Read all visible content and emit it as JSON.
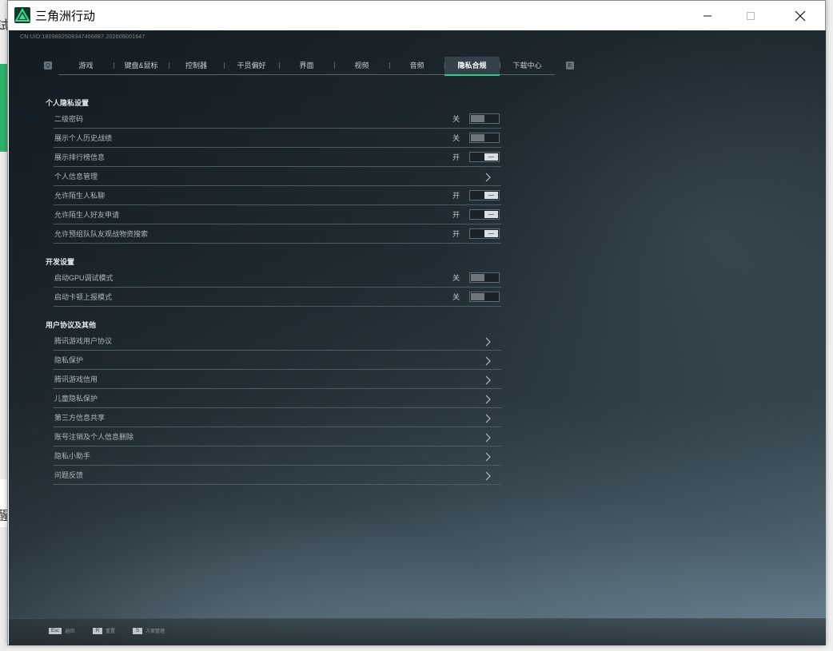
{
  "backdrop": {
    "char_top": "试",
    "char_bottom": "醒"
  },
  "window": {
    "title": "三角洲行动",
    "controls": [
      "minimize-icon",
      "maximize-icon",
      "close-icon"
    ]
  },
  "game": {
    "uid": "CN:UID:1809892508347466887.202608001647",
    "tabs": [
      {
        "label": "游戏",
        "active": false
      },
      {
        "label": "键盘&鼠标",
        "active": false
      },
      {
        "label": "控制器",
        "active": false
      },
      {
        "label": "干员偏好",
        "active": false
      },
      {
        "label": "界面",
        "active": false
      },
      {
        "label": "视频",
        "active": false
      },
      {
        "label": "音频",
        "active": false
      },
      {
        "label": "隐私合规",
        "active": true
      },
      {
        "label": "下载中心",
        "active": false
      }
    ],
    "tab_key_left": "Q",
    "tab_key_right": "E",
    "sections": [
      {
        "title": "个人隐私设置",
        "rows": [
          {
            "label": "二级密码",
            "state": "关",
            "type": "toggle-off"
          },
          {
            "label": "展示个人历史战绩",
            "state": "关",
            "type": "toggle-off"
          },
          {
            "label": "展示排行榜信息",
            "state": "开",
            "type": "toggle-on"
          },
          {
            "label": "个人信息管理",
            "state": "",
            "type": "link"
          },
          {
            "label": "允许陌生人私聊",
            "state": "开",
            "type": "toggle-on"
          },
          {
            "label": "允许陌生人好友申请",
            "state": "开",
            "type": "toggle-on"
          },
          {
            "label": "允许预组队队友观战物资搜索",
            "state": "开",
            "type": "toggle-on"
          }
        ]
      },
      {
        "title": "开发设置",
        "rows": [
          {
            "label": "启动GPU调试模式",
            "state": "关",
            "type": "toggle-off"
          },
          {
            "label": "启动卡顿上报模式",
            "state": "关",
            "type": "toggle-off"
          }
        ]
      },
      {
        "title": "用户协议及其他",
        "rows": [
          {
            "label": "腾讯游戏用户协议",
            "state": "",
            "type": "link"
          },
          {
            "label": "隐私保护",
            "state": "",
            "type": "link"
          },
          {
            "label": "腾讯游戏信用",
            "state": "",
            "type": "link"
          },
          {
            "label": "儿童隐私保护",
            "state": "",
            "type": "link"
          },
          {
            "label": "第三方信息共享",
            "state": "",
            "type": "link"
          },
          {
            "label": "账号注销及个人信息删除",
            "state": "",
            "type": "link"
          },
          {
            "label": "隐私小助手",
            "state": "",
            "type": "link"
          },
          {
            "label": "问题反馈",
            "state": "",
            "type": "link"
          }
        ]
      }
    ],
    "bottom_hints": [
      {
        "key": "Esc",
        "label": "返回"
      },
      {
        "key": "R",
        "label": "重置"
      },
      {
        "key": "S",
        "label": "方案管理"
      }
    ]
  },
  "colors": {
    "accent": "#35c98c",
    "panel_bg": "#1f2a31"
  }
}
